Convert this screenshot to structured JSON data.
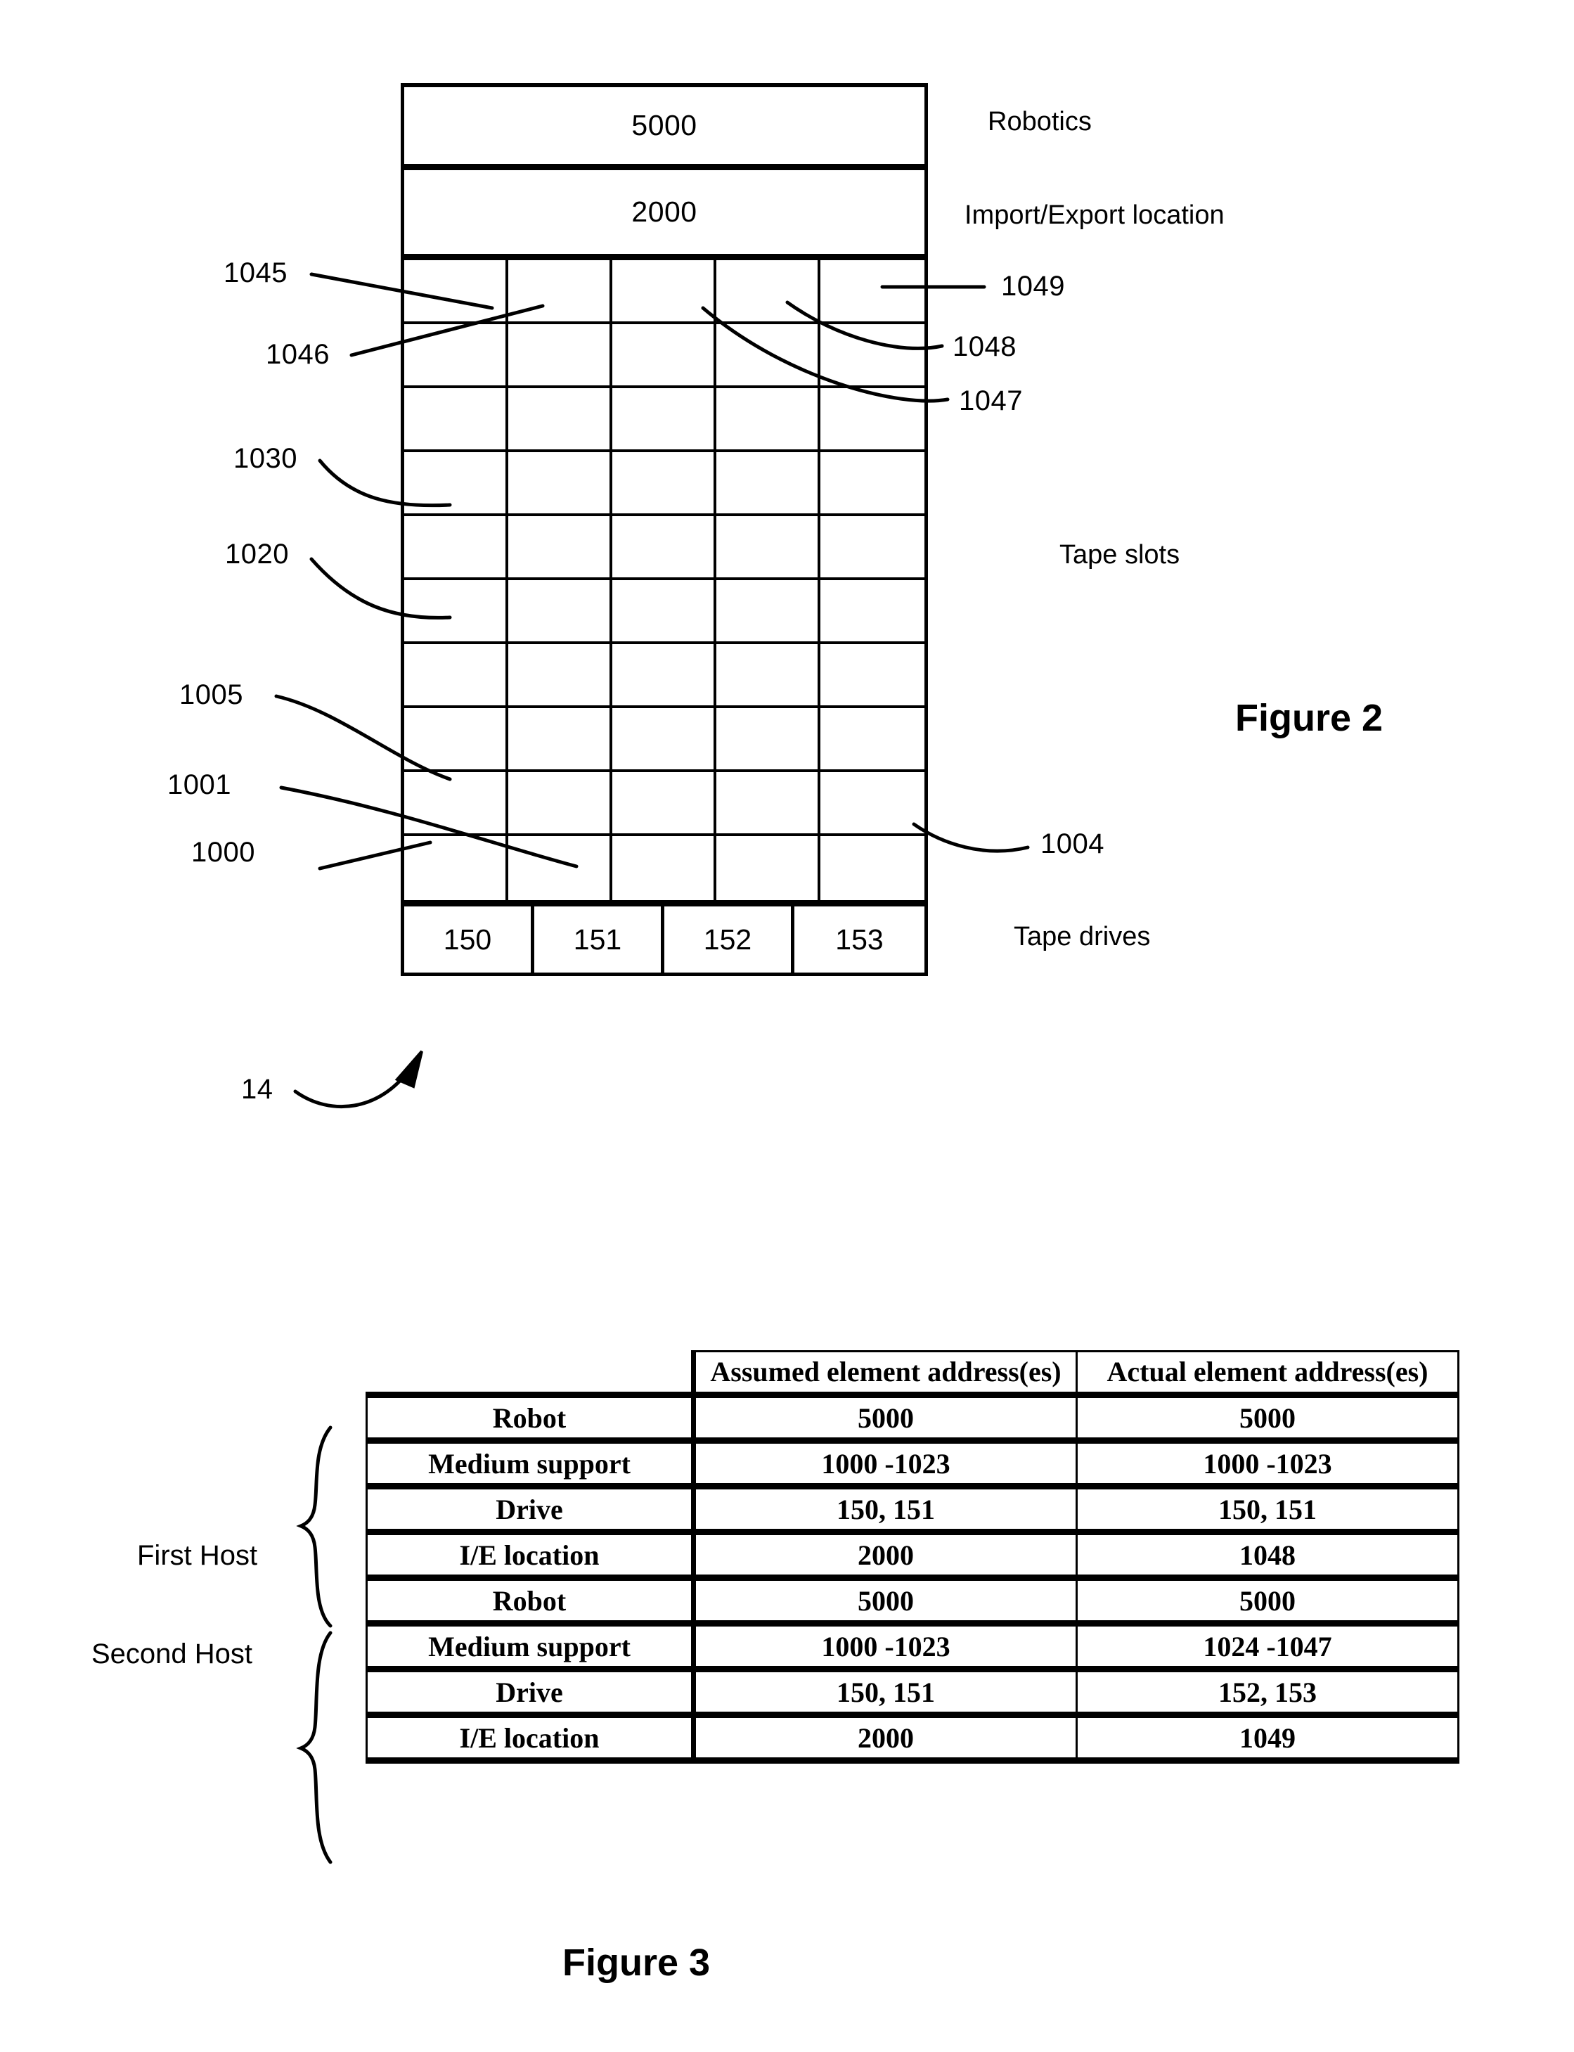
{
  "figure2": {
    "caption": "Figure 2",
    "assembly_ref": "14",
    "bands": [
      {
        "value": "5000",
        "label": "Robotics"
      },
      {
        "value": "2000",
        "label": "Import/Export location"
      }
    ],
    "slots_label": "Tape slots",
    "drives_label": "Tape drives",
    "drives": [
      "150",
      "151",
      "152",
      "153"
    ],
    "slot_grid": {
      "rows": 10,
      "columns": 5
    },
    "refs_left": [
      "1045",
      "1046",
      "1030",
      "1020",
      "1005",
      "1001",
      "1000"
    ],
    "refs_right": [
      "1049",
      "1048",
      "1047",
      "1004"
    ],
    "ref_1045": "1045",
    "ref_1046": "1046",
    "ref_1030": "1030",
    "ref_1020": "1020",
    "ref_1005": "1005",
    "ref_1001": "1001",
    "ref_1000": "1000",
    "ref_1049": "1049",
    "ref_1048": "1048",
    "ref_1047": "1047",
    "ref_1004": "1004"
  },
  "figure3": {
    "caption": "Figure 3",
    "columns": [
      "Assumed element address(es)",
      "Actual element address(es)"
    ],
    "groups": [
      {
        "name": "First Host",
        "rows": [
          {
            "element": "Robot",
            "assumed": "5000",
            "actual": "5000"
          },
          {
            "element": "Medium support",
            "assumed": "1000 -1023",
            "actual": "1000 -1023"
          },
          {
            "element": "Drive",
            "assumed": "150, 151",
            "actual": "150, 151"
          },
          {
            "element": "I/E location",
            "assumed": "2000",
            "actual": "1048"
          }
        ]
      },
      {
        "name": "Second Host",
        "rows": [
          {
            "element": "Robot",
            "assumed": "5000",
            "actual": "5000"
          },
          {
            "element": "Medium support",
            "assumed": "1000 -1023",
            "actual": "1024 -1047"
          },
          {
            "element": "Drive",
            "assumed": "150, 151",
            "actual": "152, 153"
          },
          {
            "element": "I/E location",
            "assumed": "2000",
            "actual": "1049"
          }
        ]
      }
    ]
  },
  "colors": {
    "ink": "#000000",
    "paper": "#ffffff"
  }
}
